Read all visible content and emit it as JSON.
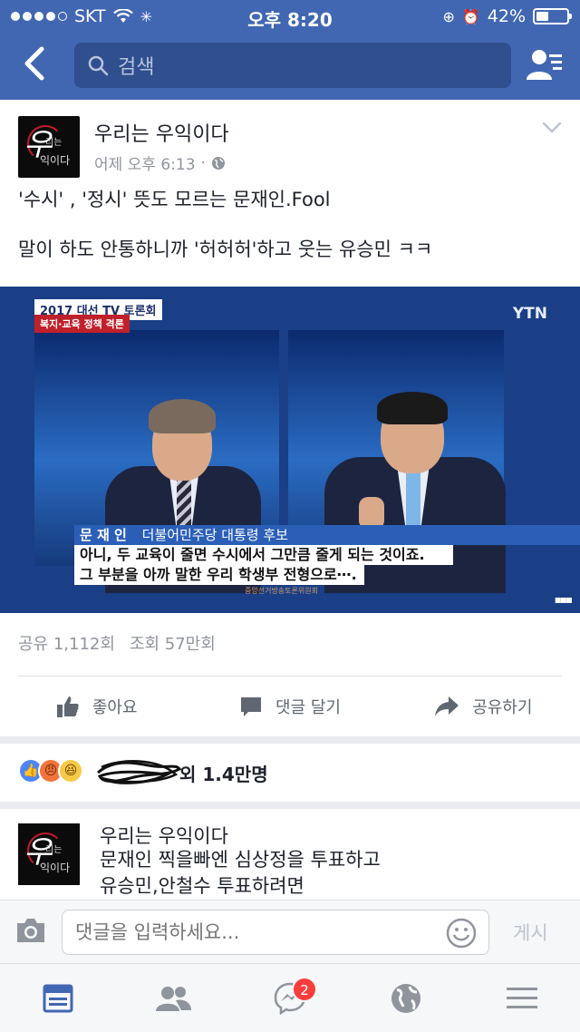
{
  "status_bar": {
    "carrier": "SKT",
    "time": "오후 8:20",
    "battery": "42%",
    "battery_level": 0.42
  },
  "nav": {
    "search_placeholder": "검색"
  },
  "post": {
    "page_name": "우리는 우익이다",
    "timestamp": "어제 오후 6:13",
    "avatar_text": {
      "glyph": "우",
      "small": "리는",
      "bottom": "익이다"
    },
    "lines": [
      "'수시' , '정시' 뜻도 모르는 문재인.Fool",
      "말이 하도 안통하니까 '허허허'하고 웃는 유승민 ㅋㅋ"
    ],
    "video": {
      "title_badge": "2017 대선 TV 토론회",
      "sub_badge": "복지·교육 정책 격론",
      "channel": "YTN",
      "speaker_name": "문 재 인",
      "speaker_role": "더불어민주당 대통령 후보",
      "caption_1": "아니, 두 교육이 줄면 수시에서 그만큼 줄게 되는 것이죠.",
      "caption_2": "그 부분을 아까 말한 우리 학생부 전형으로⋯.",
      "credit": "중앙선거방송토론위원회"
    },
    "shares": "공유 1,112회",
    "views": "조회 57만회",
    "actions": {
      "like": "좋아요",
      "comment": "댓글 달기",
      "share": "공유하기"
    }
  },
  "reactions": {
    "summary": "외 1.4만명"
  },
  "comment": {
    "name": "우리는 우익이다",
    "lines": [
      "문재인 찍을빠엔 심상정을 투표하고",
      "유승민,안철수 투표하려면"
    ]
  },
  "composer": {
    "placeholder": "댓글을 입력하세요...",
    "post_label": "게시"
  },
  "tabbar": {
    "messenger_badge": "2"
  },
  "colors": {
    "brand": "#4267b2",
    "badge": "#fa3e3e"
  }
}
